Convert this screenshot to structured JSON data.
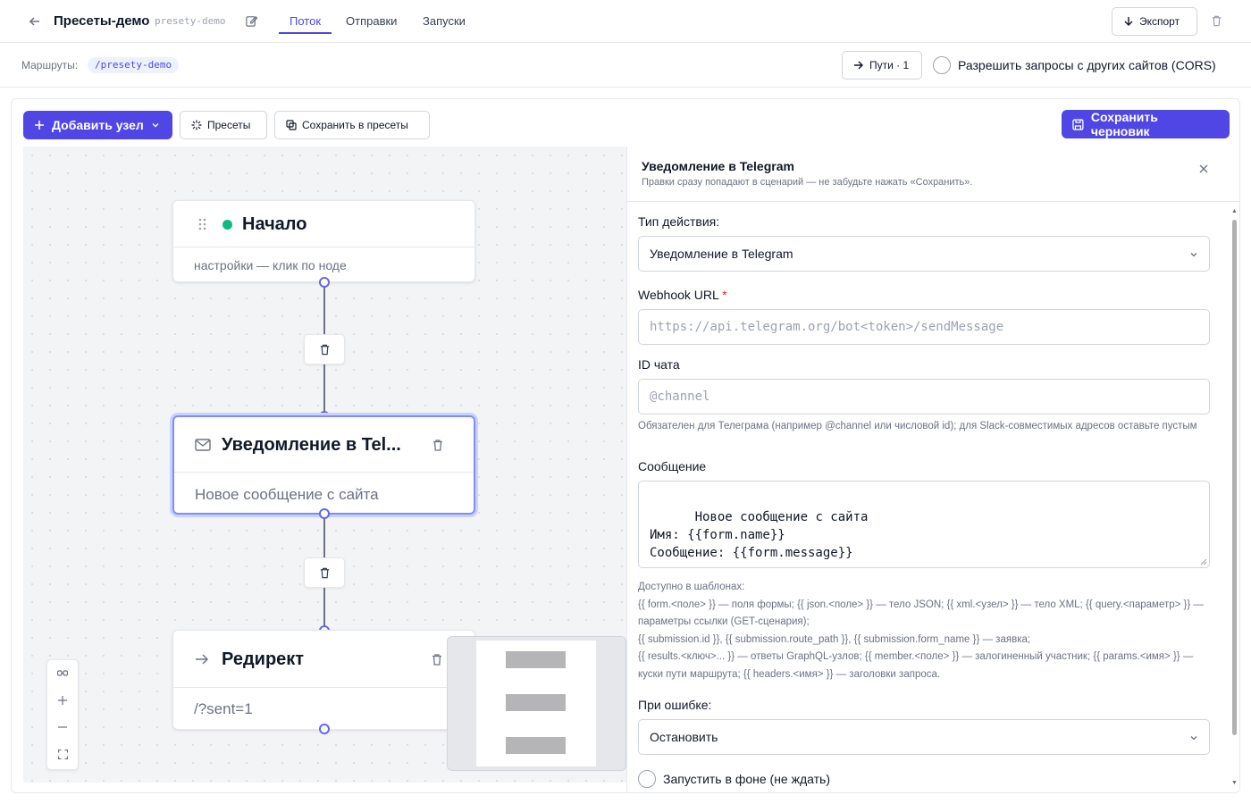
{
  "header": {
    "title": "Пресеты-демо",
    "slug": "presety-demo",
    "tabs": [
      "Поток",
      "Отправки",
      "Запуски"
    ],
    "active_tab": "Поток",
    "export_label": "Экспорт"
  },
  "routes": {
    "label": "Маршруты:",
    "route": "/presety-demo",
    "paths_label": "Пути · 1",
    "cors_label": "Разрешить запросы с других сайтов (CORS)",
    "cors_checked": false
  },
  "toolbar": {
    "add_node": "Добавить узел",
    "presets": "Пресеты",
    "save_to_presets": "Сохранить в пресеты",
    "save_draft": "Сохранить черновик"
  },
  "nodes": [
    {
      "title": "Начало",
      "subtitle": "настройки — клик по ноде"
    },
    {
      "title": "Уведомление в Tel...",
      "subtitle": "Новое сообщение с сайта"
    },
    {
      "title": "Редирект",
      "subtitle": "/?sent=1"
    }
  ],
  "panel": {
    "title": "Уведомление в Telegram",
    "subtitle": "Правки сразу попадают в сценарий — не забудьте нажать «Сохранить».",
    "action_type_label": "Тип действия:",
    "action_type_value": "Уведомление в Telegram",
    "webhook_label": "Webhook URL",
    "webhook_required": "*",
    "webhook_placeholder": "https://api.telegram.org/bot<token>/sendMessage",
    "chat_id_label": "ID чата",
    "chat_id_placeholder": "@channel",
    "chat_id_help": "Обязателен для Телеграма (например @channel или числовой id); для Slack-совместимых адресов оставьте пустым",
    "message_label": "Сообщение",
    "message_value": "Новое сообщение с сайта\nИмя: {{form.name}}\nСообщение: {{form.message}}",
    "template_help": "Доступно в шаблонах:\n{{ form.<поле> }} — поля формы; {{ json.<поле> }} — тело JSON; {{ xml.<узел> }} — тело XML; {{ query.<параметр> }} — параметры ссылки (GET-сценария);\n{{ submission.id }}, {{ submission.route_path }}, {{ submission.form_name }} — заявка;\n{{ results.<ключ>... }} — ответы GraphQL-узлов; {{ member.<поле> }} — залогиненный участник; {{ params.<имя> }} — куски пути маршрута; {{ headers.<имя> }} — заголовки запроса.",
    "on_error_label": "При ошибке:",
    "on_error_value": "Остановить",
    "background_label": "Запустить в фоне (не ждать)"
  },
  "colors": {
    "accent": "#4f46e5",
    "start_dot": "#10b981",
    "selected_border": "#818cf8"
  }
}
